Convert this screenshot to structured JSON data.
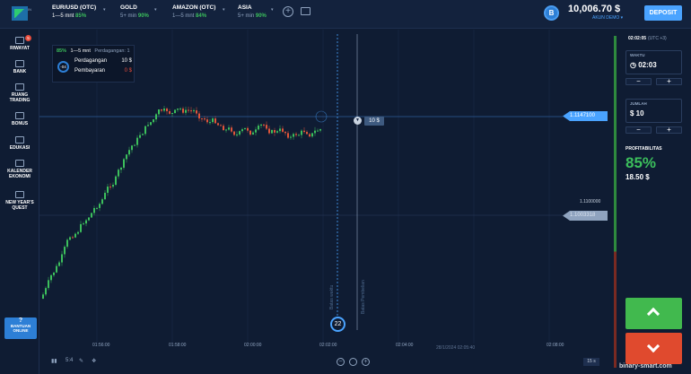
{
  "topbar": {
    "logo_sub": "IN",
    "assets": [
      {
        "name": "EUR/USD (OTC)",
        "time": "1—5 mnt",
        "pct": "85%"
      },
      {
        "name": "GOLD",
        "time": "5+ min",
        "pct": "90%"
      },
      {
        "name": "AMAZON (OTC)",
        "time": "1—5 mnt",
        "pct": "84%"
      },
      {
        "name": "ASIA",
        "time": "5+ min",
        "pct": "90%"
      }
    ],
    "add_label": "+",
    "coin_label": "B",
    "balance": "10,006.70 $",
    "account": "AKUN DEMO ▾",
    "deposit": "DEPOSIT"
  },
  "sidebar": {
    "items": [
      {
        "label": "RIWAYAT",
        "badge": "5"
      },
      {
        "label": "BANK"
      },
      {
        "label": "RUANG TRADING"
      },
      {
        "label": "BONUS"
      },
      {
        "label": "EDUKASI"
      },
      {
        "label": "KALENDER EKONOMI"
      },
      {
        "label": "NEW YEAR'S QUEST"
      }
    ],
    "help_q": "?",
    "help_label": "BANTUAN ONLINE"
  },
  "trades_box": {
    "pct": "85%",
    "time": "1—5 mnt",
    "trades_label": "Perdagangan: 1",
    "circle": "-04",
    "row1_label": "Perdagangan",
    "row1_value": "10 $",
    "row2_label": "Pembayaran",
    "row2_value": "0 $"
  },
  "chart": {
    "current_price": "1.1147100",
    "ref_price": "1.1100000",
    "grey_price": "1.1003318",
    "trade_amount": "10 $",
    "timer": "22",
    "vline1_text": "Batas waktu",
    "vline2_text": "Batas Pembelian",
    "x_labels": [
      "01:56:00",
      "01:58:00",
      "02:00:00",
      "02:02:00",
      "02:04:00",
      "02:08:00"
    ],
    "date_label": "28/1/2024 02:05:40",
    "tools_ratio": "5:4",
    "timeframe": "15 s",
    "zoom_minus": "−",
    "zoom_plus": "+"
  },
  "right_panel": {
    "clock": "02:02:05",
    "clock_tz": "(UTC +3)",
    "time_label": "WAKTU",
    "time_value": "02:03",
    "amount_label": "JUMLAH",
    "amount_value": "$ 10",
    "minus": "−",
    "plus": "+",
    "profit_label": "PROFITABILITAS",
    "profit_pct": "85%",
    "profit_amount": "18.50 $"
  },
  "watermark": "binary-smart.com",
  "colors": {
    "up": "#41b94e",
    "down": "#e04a2e",
    "accent": "#4aa3ff",
    "bg": "#0f1c33"
  }
}
